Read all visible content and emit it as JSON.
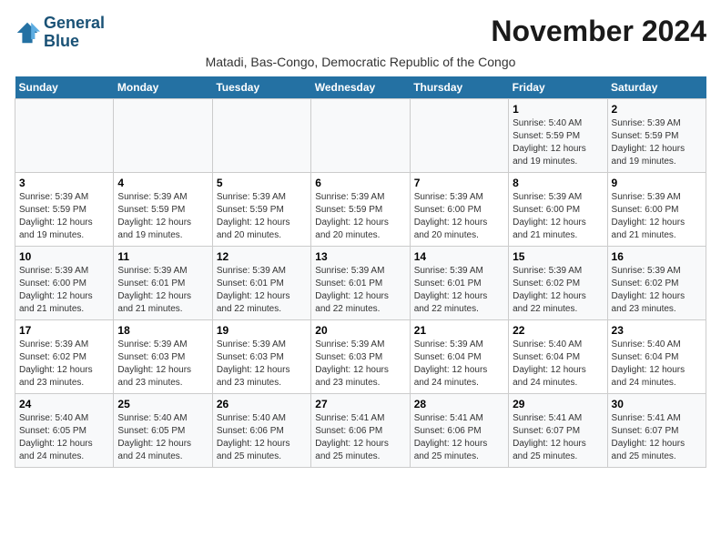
{
  "logo": {
    "line1": "General",
    "line2": "Blue"
  },
  "title": "November 2024",
  "subtitle": "Matadi, Bas-Congo, Democratic Republic of the Congo",
  "days_of_week": [
    "Sunday",
    "Monday",
    "Tuesday",
    "Wednesday",
    "Thursday",
    "Friday",
    "Saturday"
  ],
  "weeks": [
    [
      {
        "day": "",
        "info": ""
      },
      {
        "day": "",
        "info": ""
      },
      {
        "day": "",
        "info": ""
      },
      {
        "day": "",
        "info": ""
      },
      {
        "day": "",
        "info": ""
      },
      {
        "day": "1",
        "info": "Sunrise: 5:40 AM\nSunset: 5:59 PM\nDaylight: 12 hours and 19 minutes."
      },
      {
        "day": "2",
        "info": "Sunrise: 5:39 AM\nSunset: 5:59 PM\nDaylight: 12 hours and 19 minutes."
      }
    ],
    [
      {
        "day": "3",
        "info": "Sunrise: 5:39 AM\nSunset: 5:59 PM\nDaylight: 12 hours and 19 minutes."
      },
      {
        "day": "4",
        "info": "Sunrise: 5:39 AM\nSunset: 5:59 PM\nDaylight: 12 hours and 19 minutes."
      },
      {
        "day": "5",
        "info": "Sunrise: 5:39 AM\nSunset: 5:59 PM\nDaylight: 12 hours and 20 minutes."
      },
      {
        "day": "6",
        "info": "Sunrise: 5:39 AM\nSunset: 5:59 PM\nDaylight: 12 hours and 20 minutes."
      },
      {
        "day": "7",
        "info": "Sunrise: 5:39 AM\nSunset: 6:00 PM\nDaylight: 12 hours and 20 minutes."
      },
      {
        "day": "8",
        "info": "Sunrise: 5:39 AM\nSunset: 6:00 PM\nDaylight: 12 hours and 21 minutes."
      },
      {
        "day": "9",
        "info": "Sunrise: 5:39 AM\nSunset: 6:00 PM\nDaylight: 12 hours and 21 minutes."
      }
    ],
    [
      {
        "day": "10",
        "info": "Sunrise: 5:39 AM\nSunset: 6:00 PM\nDaylight: 12 hours and 21 minutes."
      },
      {
        "day": "11",
        "info": "Sunrise: 5:39 AM\nSunset: 6:01 PM\nDaylight: 12 hours and 21 minutes."
      },
      {
        "day": "12",
        "info": "Sunrise: 5:39 AM\nSunset: 6:01 PM\nDaylight: 12 hours and 22 minutes."
      },
      {
        "day": "13",
        "info": "Sunrise: 5:39 AM\nSunset: 6:01 PM\nDaylight: 12 hours and 22 minutes."
      },
      {
        "day": "14",
        "info": "Sunrise: 5:39 AM\nSunset: 6:01 PM\nDaylight: 12 hours and 22 minutes."
      },
      {
        "day": "15",
        "info": "Sunrise: 5:39 AM\nSunset: 6:02 PM\nDaylight: 12 hours and 22 minutes."
      },
      {
        "day": "16",
        "info": "Sunrise: 5:39 AM\nSunset: 6:02 PM\nDaylight: 12 hours and 23 minutes."
      }
    ],
    [
      {
        "day": "17",
        "info": "Sunrise: 5:39 AM\nSunset: 6:02 PM\nDaylight: 12 hours and 23 minutes."
      },
      {
        "day": "18",
        "info": "Sunrise: 5:39 AM\nSunset: 6:03 PM\nDaylight: 12 hours and 23 minutes."
      },
      {
        "day": "19",
        "info": "Sunrise: 5:39 AM\nSunset: 6:03 PM\nDaylight: 12 hours and 23 minutes."
      },
      {
        "day": "20",
        "info": "Sunrise: 5:39 AM\nSunset: 6:03 PM\nDaylight: 12 hours and 23 minutes."
      },
      {
        "day": "21",
        "info": "Sunrise: 5:39 AM\nSunset: 6:04 PM\nDaylight: 12 hours and 24 minutes."
      },
      {
        "day": "22",
        "info": "Sunrise: 5:40 AM\nSunset: 6:04 PM\nDaylight: 12 hours and 24 minutes."
      },
      {
        "day": "23",
        "info": "Sunrise: 5:40 AM\nSunset: 6:04 PM\nDaylight: 12 hours and 24 minutes."
      }
    ],
    [
      {
        "day": "24",
        "info": "Sunrise: 5:40 AM\nSunset: 6:05 PM\nDaylight: 12 hours and 24 minutes."
      },
      {
        "day": "25",
        "info": "Sunrise: 5:40 AM\nSunset: 6:05 PM\nDaylight: 12 hours and 24 minutes."
      },
      {
        "day": "26",
        "info": "Sunrise: 5:40 AM\nSunset: 6:06 PM\nDaylight: 12 hours and 25 minutes."
      },
      {
        "day": "27",
        "info": "Sunrise: 5:41 AM\nSunset: 6:06 PM\nDaylight: 12 hours and 25 minutes."
      },
      {
        "day": "28",
        "info": "Sunrise: 5:41 AM\nSunset: 6:06 PM\nDaylight: 12 hours and 25 minutes."
      },
      {
        "day": "29",
        "info": "Sunrise: 5:41 AM\nSunset: 6:07 PM\nDaylight: 12 hours and 25 minutes."
      },
      {
        "day": "30",
        "info": "Sunrise: 5:41 AM\nSunset: 6:07 PM\nDaylight: 12 hours and 25 minutes."
      }
    ]
  ],
  "colors": {
    "header_bg": "#2471a3",
    "header_text": "#ffffff",
    "title_color": "#1a1a1a"
  }
}
